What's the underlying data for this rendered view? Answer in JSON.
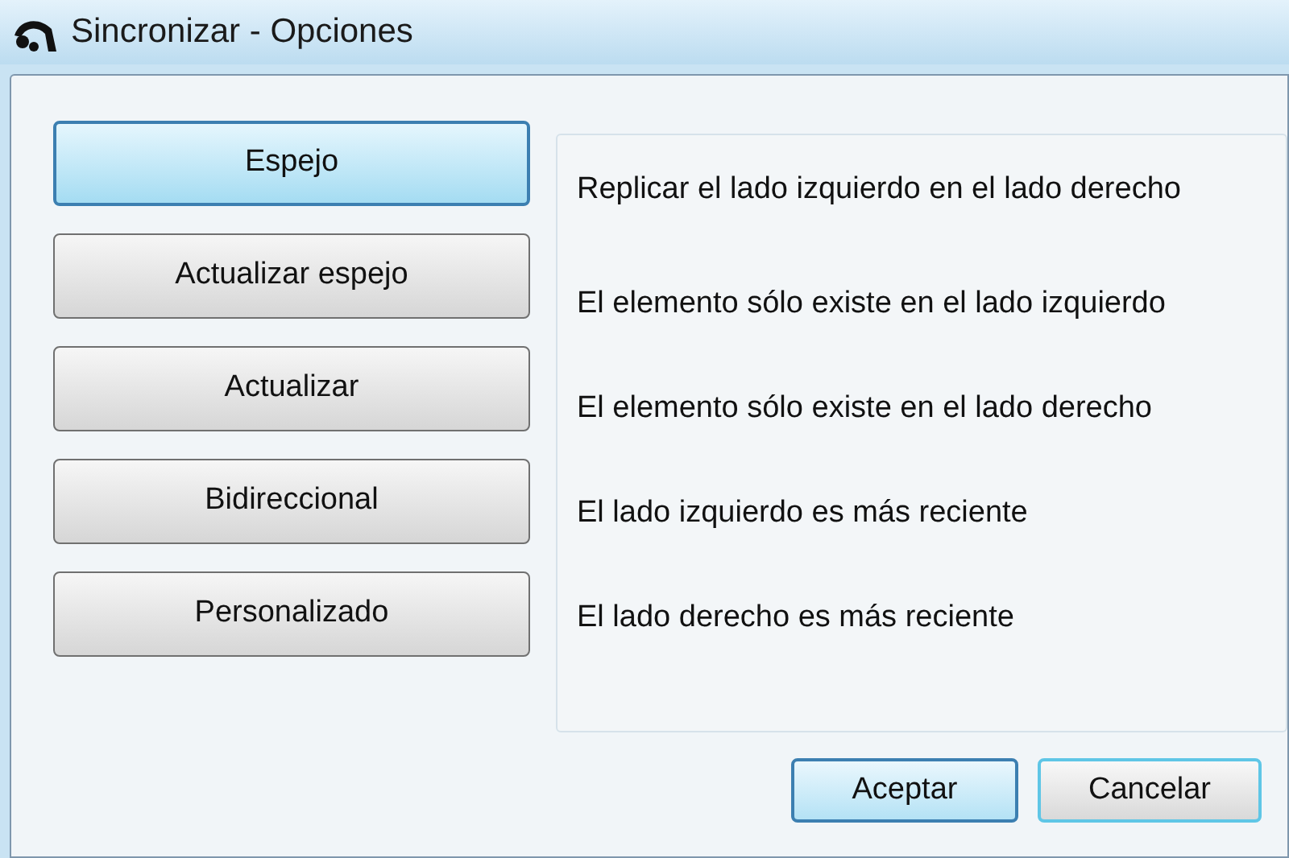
{
  "window": {
    "title": "Sincronizar - Opciones"
  },
  "modes": [
    {
      "label": "Espejo",
      "selected": true
    },
    {
      "label": "Actualizar espejo",
      "selected": false
    },
    {
      "label": "Actualizar",
      "selected": false
    },
    {
      "label": "Bidireccional",
      "selected": false
    },
    {
      "label": "Personalizado",
      "selected": false
    }
  ],
  "description": "Replicar el lado izquierdo en el lado derecho",
  "rules": [
    "El elemento sólo existe en el lado izquierdo",
    "El elemento sólo existe en el lado derecho",
    "El lado izquierdo es más reciente",
    "El lado derecho es más reciente"
  ],
  "buttons": [
    {
      "label": "Aceptar",
      "default": true
    },
    {
      "label": "Cancelar",
      "default": false
    }
  ]
}
